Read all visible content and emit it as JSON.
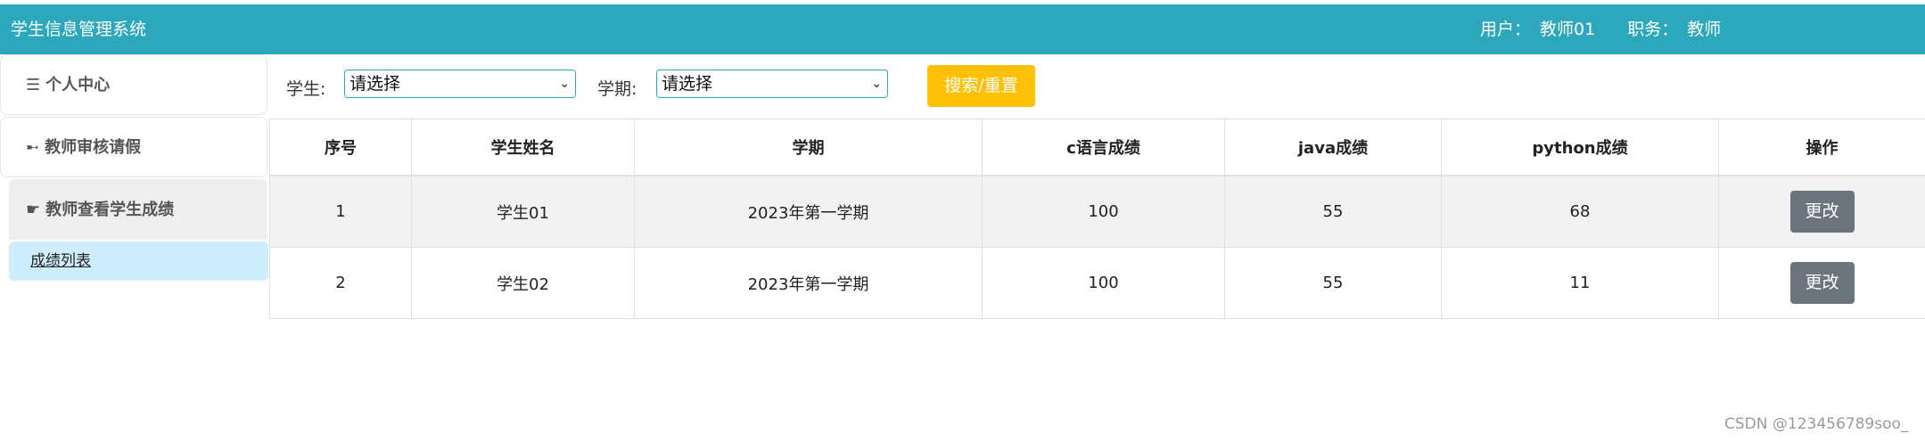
{
  "header": {
    "title": "学生信息管理系统",
    "user_label": "用户：",
    "user_name": "教师01",
    "role_label": "职务：",
    "role_name": "教师"
  },
  "sidebar": {
    "items": [
      {
        "icon": "menu-icon",
        "glyph": "☰",
        "label": "个人中心"
      },
      {
        "icon": "key-icon",
        "glyph": "➸",
        "label": "教师审核请假"
      },
      {
        "icon": "pointing-hand-icon",
        "glyph": "☛",
        "label": "教师查看学生成绩"
      }
    ],
    "sub_item": "成绩列表"
  },
  "filters": {
    "student_label": "学生:",
    "student_value": "请选择",
    "term_label": "学期:",
    "term_value": "请选择",
    "search_button": "搜索/重置"
  },
  "table": {
    "columns": [
      "序号",
      "学生姓名",
      "学期",
      "c语言成绩",
      "java成绩",
      "python成绩",
      "操作"
    ],
    "rows": [
      {
        "no": "1",
        "name": "学生01",
        "term": "2023年第一学期",
        "c": "100",
        "java": "55",
        "python": "68",
        "action": "更改"
      },
      {
        "no": "2",
        "name": "学生02",
        "term": "2023年第一学期",
        "c": "100",
        "java": "55",
        "python": "11",
        "action": "更改"
      }
    ]
  },
  "watermark": "CSDN @123456789soo_"
}
